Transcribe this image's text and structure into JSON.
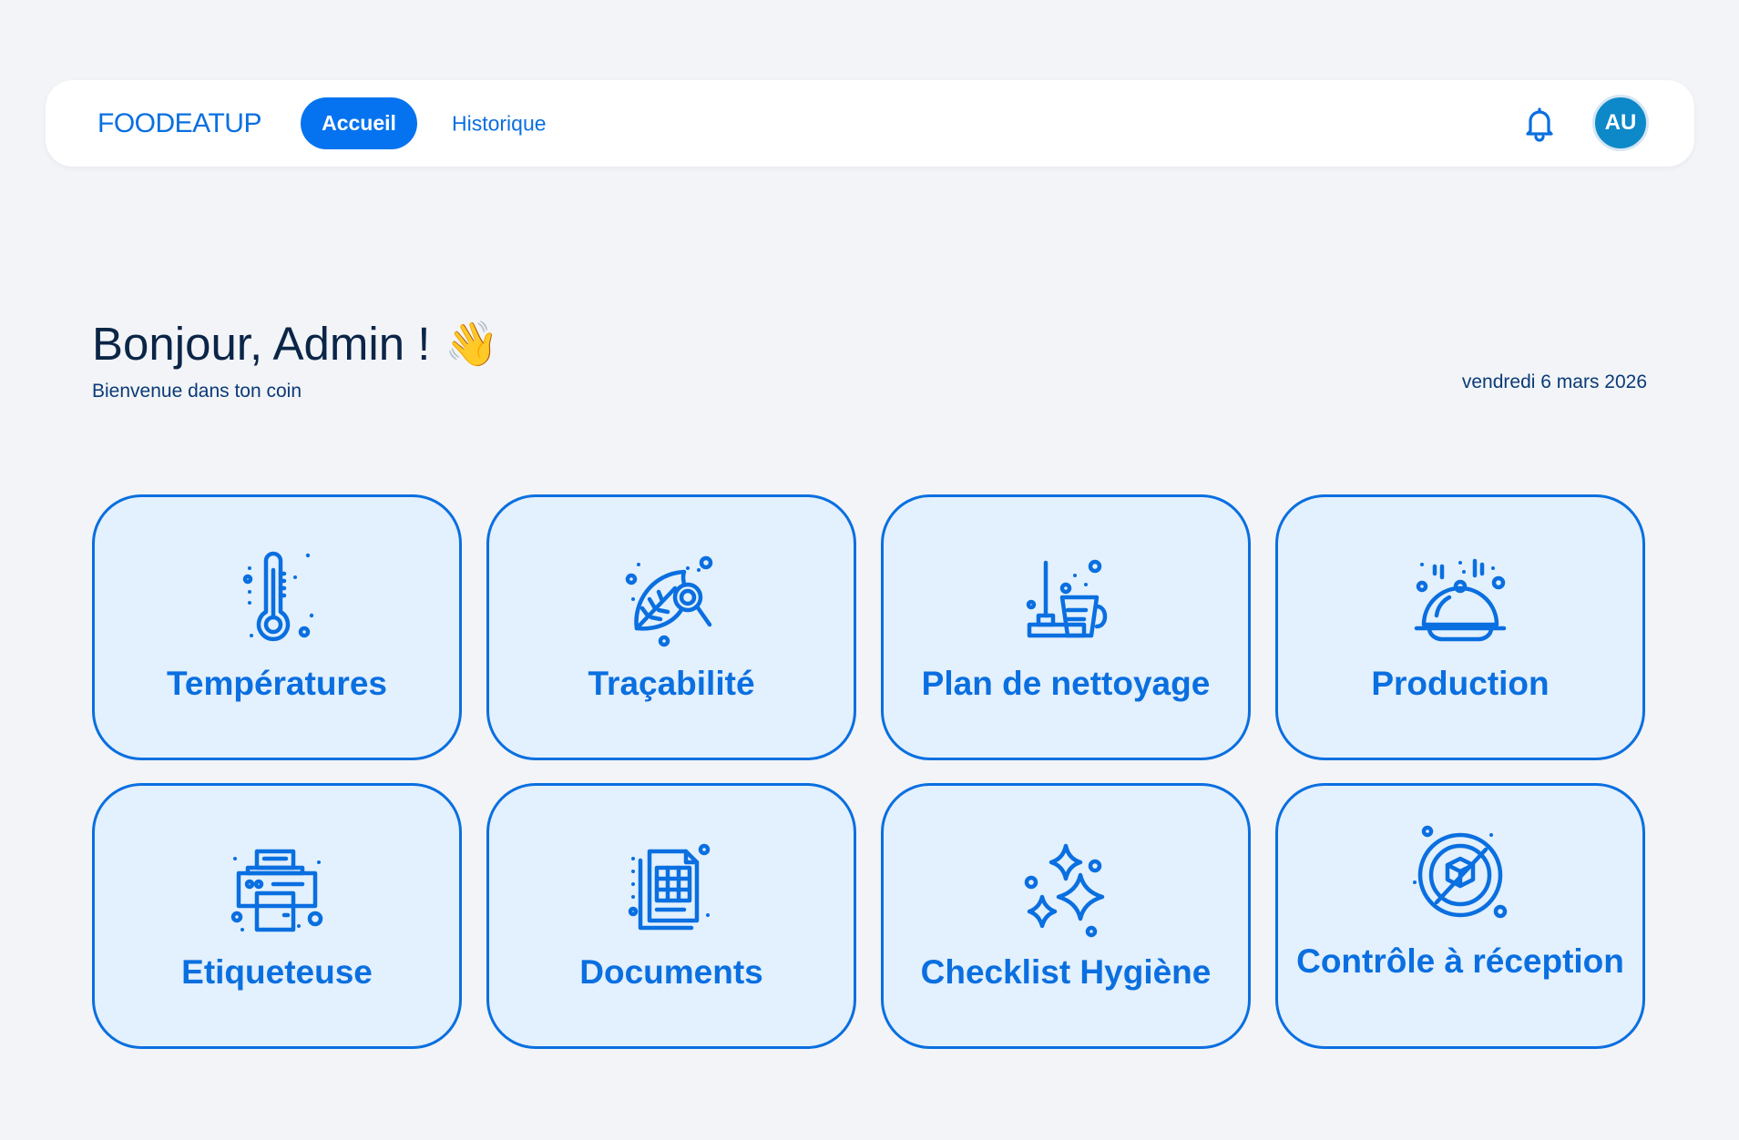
{
  "header": {
    "logo": "FOODEATUP",
    "nav": [
      {
        "label": "Accueil",
        "active": true
      },
      {
        "label": "Historique",
        "active": false
      }
    ],
    "avatar_initials": "AU"
  },
  "welcome": {
    "greeting": "Bonjour, Admin !",
    "subtitle": "Bienvenue dans ton coin",
    "date": "vendredi 6 mars 2026"
  },
  "tiles": [
    {
      "label": "Températures",
      "icon": "thermometer-icon"
    },
    {
      "label": "Traçabilité",
      "icon": "leaf-search-icon"
    },
    {
      "label": "Plan de nettoyage",
      "icon": "cleaning-icon"
    },
    {
      "label": "Production",
      "icon": "cloche-icon"
    },
    {
      "label": "Etiqueteuse",
      "icon": "printer-icon"
    },
    {
      "label": "Documents",
      "icon": "documents-icon"
    },
    {
      "label": "Checklist Hygiène",
      "icon": "sparkles-icon"
    },
    {
      "label": "Contrôle à réception",
      "icon": "package-inspection-icon"
    }
  ],
  "colors": {
    "accent": "#0a6fe0",
    "tile_bg": "#e3f0fd",
    "avatar_bg": "#0d88c9"
  }
}
